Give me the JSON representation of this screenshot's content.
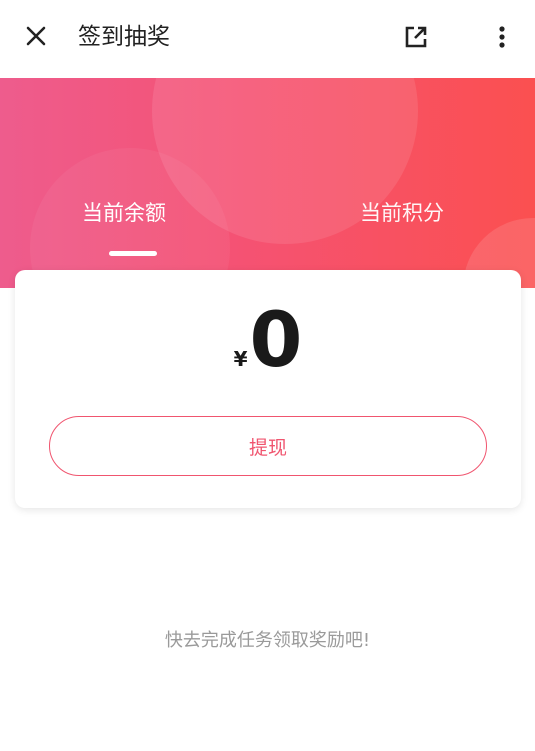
{
  "header": {
    "title": "签到抽奖",
    "close_icon": "close-icon",
    "share_icon": "open-external-icon",
    "more_icon": "more-vertical-icon"
  },
  "hero": {
    "tabs": [
      {
        "label": "当前余额",
        "active": true
      },
      {
        "label": "当前积分",
        "active": false
      }
    ],
    "gradient_colors": [
      "#ee5c8d",
      "#f55273",
      "#fb5050"
    ]
  },
  "balance_card": {
    "currency_symbol": "¥",
    "amount": "0",
    "withdraw_label": "提现",
    "accent_color": "#f0556f"
  },
  "hint_text": "快去完成任务领取奖励吧!"
}
